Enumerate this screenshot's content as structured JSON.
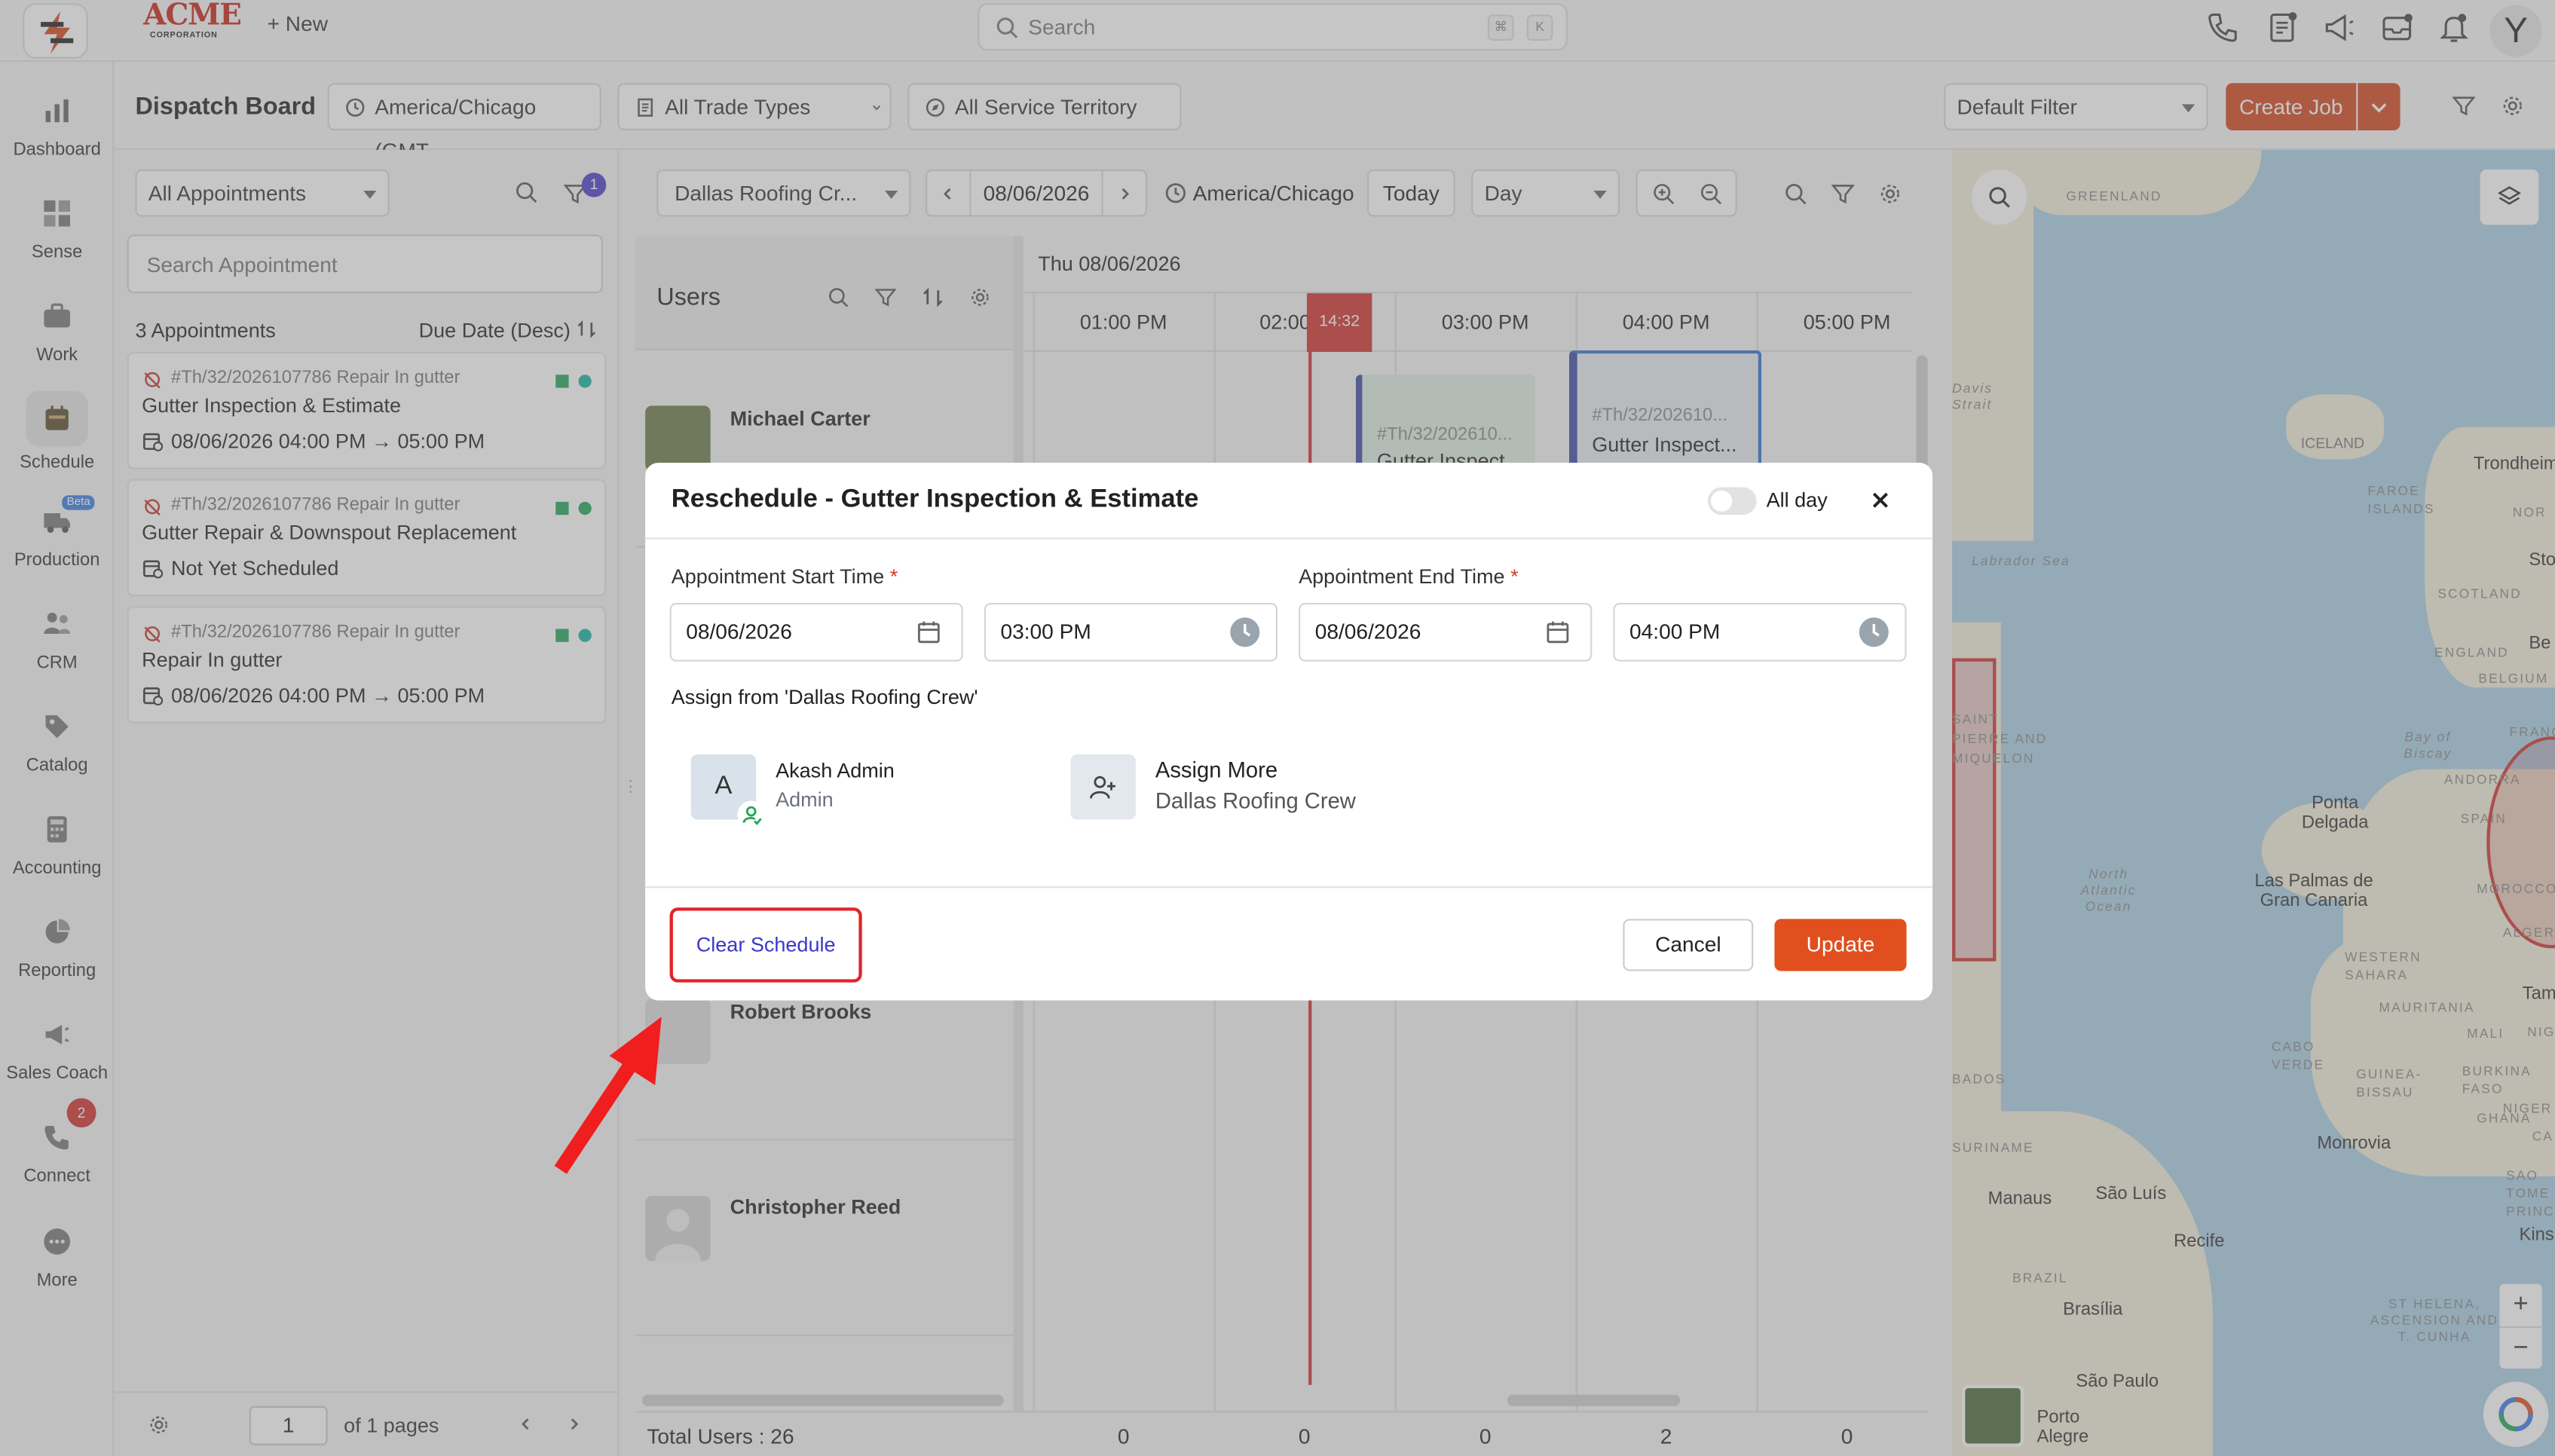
{
  "brand": {
    "name": "ACME",
    "sub": "CORPORATION"
  },
  "topbar": {
    "new_label": "+ New",
    "search_placeholder": "Search",
    "kbd1": "⌘",
    "kbd2": "K",
    "avatar_letter": "Y"
  },
  "sidebar": {
    "items": [
      {
        "label": "Dashboard",
        "icon": "bar-chart-icon"
      },
      {
        "label": "Sense",
        "icon": "grid-icon"
      },
      {
        "label": "Work",
        "icon": "briefcase-icon"
      },
      {
        "label": "Schedule",
        "icon": "calendar-icon",
        "active": true
      },
      {
        "label": "Production",
        "icon": "truck-icon",
        "badge": "Beta"
      },
      {
        "label": "CRM",
        "icon": "people-icon"
      },
      {
        "label": "Catalog",
        "icon": "tag-icon"
      },
      {
        "label": "Accounting",
        "icon": "calculator-icon"
      },
      {
        "label": "Reporting",
        "icon": "pie-chart-icon"
      },
      {
        "label": "Sales Coach",
        "icon": "megaphone-icon"
      },
      {
        "label": "Connect",
        "icon": "phone-icon",
        "badge": "2"
      },
      {
        "label": "More",
        "icon": "more-icon"
      }
    ]
  },
  "header": {
    "title": "Dispatch Board",
    "timezone": "America/Chicago (GMT...",
    "trade_types": "All Trade Types",
    "territory": "All Service Territory",
    "filter": "Default Filter",
    "create_job": "Create Job"
  },
  "left_panel": {
    "appointments_filter": "All Appointments",
    "filter_badge": "1",
    "search_placeholder": "Search Appointment",
    "count": "3 Appointments",
    "sort": "Due Date (Desc)",
    "cards": [
      {
        "code": "#Th/32/2026107786 Repair In gutter",
        "title": "Gutter Inspection & Estimate",
        "date": "08/06/2026 04:00 PM  →  05:00 PM"
      },
      {
        "code": "#Th/32/2026107786 Repair In gutter",
        "title": "Gutter Repair & Downspout Replacement",
        "date": "Not Yet Scheduled"
      },
      {
        "code": "#Th/32/2026107786 Repair In gutter",
        "title": "Repair In gutter",
        "date": "08/06/2026 04:00 PM  →  05:00 PM"
      }
    ],
    "page_input": "1",
    "page_of": "of 1 pages"
  },
  "scheduler": {
    "crew": "Dallas Roofing Cr...",
    "date": "08/06/2026",
    "timezone": "America/Chicago",
    "today": "Today",
    "view": "Day",
    "users_label": "Users",
    "day_label": "Thu 08/06/2026",
    "hours": [
      "01:00 PM",
      "02:00",
      "03:00 PM",
      "04:00 PM",
      "05:00 PM"
    ],
    "now_marker": "14:32",
    "users": [
      "Michael Carter",
      "Robert Brooks",
      "Christopher Reed"
    ],
    "events": [
      {
        "code": "#Th/32/202610...",
        "title": "Gutter Inspect..."
      },
      {
        "code": "#Th/32/202610...",
        "title": "Gutter Inspect..."
      }
    ],
    "total_users": "Total Users : 26",
    "totals": [
      "0",
      "0",
      "0",
      "2",
      "0"
    ]
  },
  "map": {
    "labels": [
      "GREENLAND",
      "ICELAND",
      "Trondheim",
      "FAROE ISLANDS",
      "SCOTLAND",
      "ENGLAND",
      "BELGIUM",
      "FRANCE",
      "ANDORRA",
      "SPAIN",
      "Ponta Delgada",
      "MOROCCO",
      "ALGERIA",
      "Las Palmas de Gran Canaria",
      "WESTERN SAHARA",
      "MAURITANIA",
      "MALI",
      "CABO VERDE",
      "GUINEA-BISSAU",
      "BURKINA FASO",
      "GHANA",
      "Monrovia",
      "SURINAME",
      "Manaus",
      "São Luís",
      "Recife",
      "BRAZIL",
      "Brasília",
      "São Paulo",
      "Porto Alegre",
      "ST HELENA, ASCENSION AND T. CUNHA",
      "SAO TOME PRINCIPE",
      "NIGER",
      "Kins",
      "BADOS",
      "Labrador Sea",
      "Davis Strait",
      "North Atlantic Ocean",
      "Bay of Biscay",
      "SAINT PIERRE AND MIQUELON",
      "Sto",
      "Be",
      "NOR",
      "Tam",
      "NIG",
      "CA"
    ]
  },
  "modal": {
    "title": "Reschedule - Gutter Inspection & Estimate",
    "all_day": "All day",
    "start_label": "Appointment Start Time",
    "end_label": "Appointment End Time",
    "required_mark": "*",
    "start_date": "08/06/2026",
    "start_time": "03:00 PM",
    "end_date": "08/06/2026",
    "end_time": "04:00 PM",
    "assign_from": "Assign from 'Dallas Roofing Crew'",
    "assignee": {
      "initial": "A",
      "name": "Akash Admin",
      "role": "Admin"
    },
    "assign_more": {
      "label": "Assign More",
      "sub": "Dallas Roofing Crew"
    },
    "clear_schedule": "Clear Schedule",
    "cancel": "Cancel",
    "update": "Update"
  },
  "colors": {
    "accent": "#d4461e",
    "update": "#e14f1e",
    "highlight": "#e0242a",
    "link": "#3c36c9",
    "now_line": "#d0312d"
  }
}
